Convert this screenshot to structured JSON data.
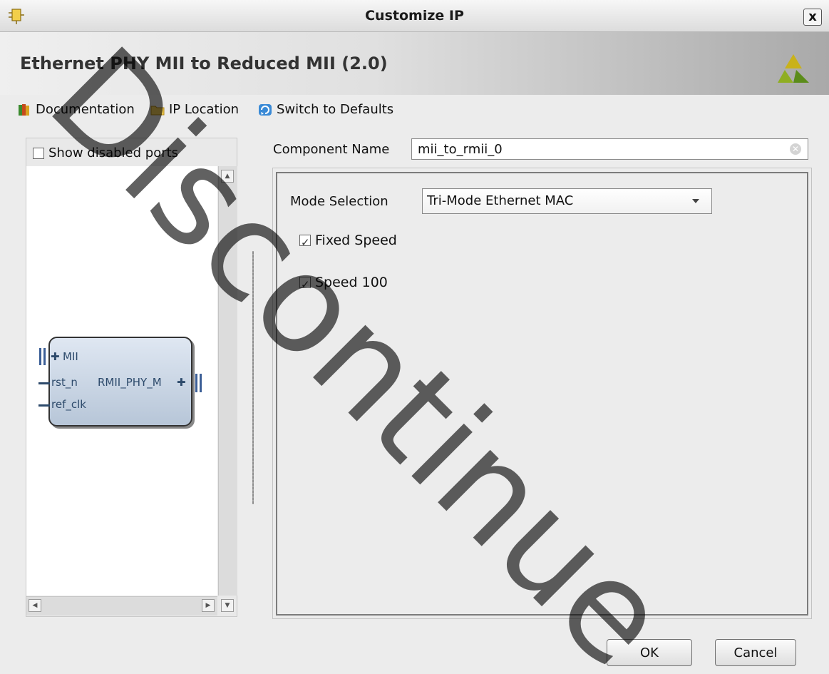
{
  "window": {
    "title": "Customize IP",
    "close_label": "x"
  },
  "banner": {
    "title": "Ethernet PHY MII to Reduced MII (2.0)"
  },
  "toolbar": {
    "documentation": "Documentation",
    "ip_location": "IP Location",
    "switch_defaults": "Switch to Defaults"
  },
  "left_panel": {
    "show_disabled_label": "Show disabled ports",
    "show_disabled_checked": false,
    "block": {
      "port_mii": "MII",
      "port_rst": "rst_n",
      "port_rmii": "RMII_PHY_M",
      "port_ref_clk": "ref_clk"
    }
  },
  "form": {
    "component_name_label": "Component Name",
    "component_name_value": "mii_to_rmii_0",
    "mode_label": "Mode Selection",
    "mode_value": "Tri-Mode Ethernet MAC",
    "fixed_speed_label": "Fixed Speed",
    "fixed_speed_checked": true,
    "speed100_label": "Speed 100",
    "speed100_checked": true
  },
  "buttons": {
    "ok": "OK",
    "cancel": "Cancel"
  },
  "watermark": "Discontinue",
  "colors": {
    "accent": "#3b5e96",
    "block_fill": "#c6d3e3",
    "watermark": "#000000"
  }
}
